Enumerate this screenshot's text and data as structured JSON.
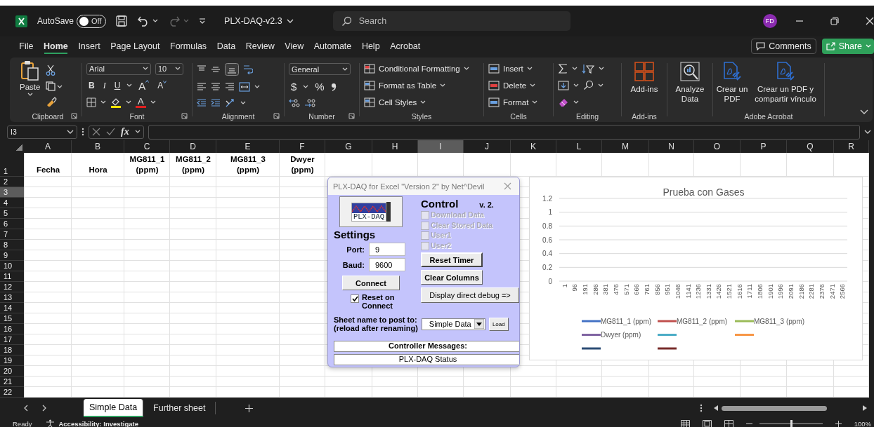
{
  "title_bar": {
    "autosave_label": "AutoSave",
    "autosave": {
      "on": false,
      "label": "Off"
    },
    "file_name": "PLX-DAQ-v2.3",
    "search_placeholder": "Search",
    "avatar": "FD"
  },
  "menu_tabs": [
    {
      "label": "File",
      "selected": false
    },
    {
      "label": "Home",
      "selected": true
    },
    {
      "label": "Insert",
      "selected": false
    },
    {
      "label": "Page Layout",
      "selected": false
    },
    {
      "label": "Formulas",
      "selected": false
    },
    {
      "label": "Data",
      "selected": false
    },
    {
      "label": "Review",
      "selected": false
    },
    {
      "label": "View",
      "selected": false
    },
    {
      "label": "Automate",
      "selected": false
    },
    {
      "label": "Help",
      "selected": false
    },
    {
      "label": "Acrobat",
      "selected": false
    }
  ],
  "header_buttons": {
    "comments": "Comments",
    "share": "Share"
  },
  "ribbon": {
    "clipboard": {
      "paste": "Paste",
      "label": "Clipboard"
    },
    "font": {
      "name": "Arial",
      "size": "10",
      "format_buttons": [
        "B",
        "I",
        "U"
      ],
      "grow": "A",
      "shrink": "A",
      "font_color": "A",
      "label": "Font"
    },
    "alignment": {
      "label": "Alignment"
    },
    "number": {
      "format": "General",
      "currency": "$",
      "percent": "%",
      "label": "Number"
    },
    "styles": {
      "items": [
        "Conditional Formatting",
        "Format as Table",
        "Cell Styles"
      ],
      "label": "Styles"
    },
    "cells": {
      "items": [
        "Insert",
        "Delete",
        "Format"
      ],
      "label": "Cells"
    },
    "editing": {
      "label": "Editing"
    },
    "addins": {
      "button": "Add-ins",
      "label": "Add-ins"
    },
    "analyze": {
      "button": "Analyze Data"
    },
    "acrobat": {
      "buttons": [
        "Crear un PDF",
        "Crear un PDF y compartir vínculo"
      ],
      "label": "Adobe Acrobat"
    }
  },
  "formula_bar": {
    "name_box": "I3",
    "function_label": "fx"
  },
  "sheet": {
    "columns": [
      {
        "label": "A",
        "selected": false
      },
      {
        "label": "B",
        "selected": false
      },
      {
        "label": "C",
        "selected": false
      },
      {
        "label": "D",
        "selected": false
      },
      {
        "label": "E",
        "selected": false
      },
      {
        "label": "F",
        "selected": false
      },
      {
        "label": "G",
        "selected": false
      },
      {
        "label": "H",
        "selected": false
      },
      {
        "label": "I",
        "selected": true
      },
      {
        "label": "J",
        "selected": false
      },
      {
        "label": "K",
        "selected": false
      },
      {
        "label": "L",
        "selected": false
      },
      {
        "label": "M",
        "selected": false
      },
      {
        "label": "N",
        "selected": false
      },
      {
        "label": "O",
        "selected": false
      },
      {
        "label": "P",
        "selected": false
      },
      {
        "label": "Q",
        "selected": false
      },
      {
        "label": "R",
        "selected": false
      }
    ],
    "rows": [
      {
        "label": "1",
        "selected": false
      },
      {
        "label": "2",
        "selected": false
      },
      {
        "label": "3",
        "selected": true
      },
      {
        "label": "4",
        "selected": false
      },
      {
        "label": "5",
        "selected": false
      },
      {
        "label": "6",
        "selected": false
      },
      {
        "label": "7",
        "selected": false
      },
      {
        "label": "8",
        "selected": false
      },
      {
        "label": "9",
        "selected": false
      },
      {
        "label": "10",
        "selected": false
      },
      {
        "label": "11",
        "selected": false
      },
      {
        "label": "12",
        "selected": false
      },
      {
        "label": "13",
        "selected": false
      },
      {
        "label": "14",
        "selected": false
      },
      {
        "label": "15",
        "selected": false
      },
      {
        "label": "16",
        "selected": false
      },
      {
        "label": "17",
        "selected": false
      },
      {
        "label": "18",
        "selected": false
      },
      {
        "label": "19",
        "selected": false
      },
      {
        "label": "20",
        "selected": false
      },
      {
        "label": "21",
        "selected": false
      },
      {
        "label": "22",
        "selected": false
      }
    ],
    "header_cells": [
      "Fecha",
      "Hora",
      "MG811_1 (ppm)",
      "MG811_2 (ppm)",
      "MG811_3 (ppm)",
      "Dwyer (ppm)"
    ]
  },
  "dialog": {
    "title": "PLX-DAQ for Excel \"Version 2\" by Net^Devil",
    "logo_text": "PLX-DAQ",
    "settings_heading": "Settings",
    "port_label": "Port:",
    "port_value": "9",
    "baud_label": "Baud:",
    "baud_value": "9600",
    "connect": "Connect",
    "reset_on_connect": {
      "label": "Reset on Connect",
      "checked": true
    },
    "control_heading": "Control",
    "version": "v. 2.",
    "control_options": [
      {
        "label": "Download Data",
        "checked": false,
        "disabled": true
      },
      {
        "label": "Clear Stored Data",
        "checked": false,
        "disabled": true
      },
      {
        "label": "User1",
        "checked": false,
        "disabled": true
      },
      {
        "label": "User2",
        "checked": false,
        "disabled": true
      }
    ],
    "control_buttons": [
      "Reset Timer",
      "Clear Columns",
      "Display direct debug =>"
    ],
    "sheet_label": "Sheet name to post to:",
    "sheet_hint": "(reload after renaming)",
    "sheet_value": "Simple Data",
    "load": "Load",
    "messages_label": "Controller Messages:",
    "status": "PLX-DAQ Status"
  },
  "chart": {
    "chart_data": {
      "type": "line",
      "title": "Prueba con Gases",
      "categories": [
        "1",
        "96",
        "191",
        "286",
        "381",
        "476",
        "571",
        "666",
        "761",
        "856",
        "951",
        "1046",
        "1141",
        "1236",
        "1331",
        "1426",
        "1521",
        "1616",
        "1711",
        "1806",
        "1901",
        "1996",
        "2091",
        "2186",
        "2281",
        "2376",
        "2471",
        "2566"
      ],
      "ylim": [
        0,
        1.2
      ],
      "grid": true,
      "yticks": [
        0,
        0.2,
        0.4,
        0.6,
        0.8,
        1,
        1.2
      ],
      "series": [
        {
          "name": "MG811_1 (ppm)",
          "color": "#4472c4",
          "values": [
            null,
            null,
            null,
            null,
            null,
            null,
            null,
            null,
            null,
            null,
            null,
            null,
            null,
            null,
            null,
            null,
            null,
            null,
            null,
            null,
            null,
            null,
            null,
            null,
            null,
            null,
            null,
            null
          ]
        },
        {
          "name": "MG811_2 (ppm)",
          "color": "#c0504d",
          "values": [
            null,
            null,
            null,
            null,
            null,
            null,
            null,
            null,
            null,
            null,
            null,
            null,
            null,
            null,
            null,
            null,
            null,
            null,
            null,
            null,
            null,
            null,
            null,
            null,
            null,
            null,
            null,
            null
          ]
        },
        {
          "name": "MG811_3 (ppm)",
          "color": "#9bbb59",
          "values": [
            null,
            null,
            null,
            null,
            null,
            null,
            null,
            null,
            null,
            null,
            null,
            null,
            null,
            null,
            null,
            null,
            null,
            null,
            null,
            null,
            null,
            null,
            null,
            null,
            null,
            null,
            null,
            null
          ]
        },
        {
          "name": "Dwyer (ppm)",
          "color": "#8064a2",
          "values": [
            null,
            null,
            null,
            null,
            null,
            null,
            null,
            null,
            null,
            null,
            null,
            null,
            null,
            null,
            null,
            null,
            null,
            null,
            null,
            null,
            null,
            null,
            null,
            null,
            null,
            null,
            null,
            null
          ]
        },
        {
          "color": "#4bacc6",
          "values": [
            null,
            null,
            null,
            null,
            null,
            null,
            null,
            null,
            null,
            null,
            null,
            null,
            null,
            null,
            null,
            null,
            null,
            null,
            null,
            null,
            null,
            null,
            null,
            null,
            null,
            null,
            null,
            null
          ]
        },
        {
          "color": "#f79646",
          "values": [
            null,
            null,
            null,
            null,
            null,
            null,
            null,
            null,
            null,
            null,
            null,
            null,
            null,
            null,
            null,
            null,
            null,
            null,
            null,
            null,
            null,
            null,
            null,
            null,
            null,
            null,
            null,
            null
          ]
        },
        {
          "color": "#2c4d75",
          "values": [
            null,
            null,
            null,
            null,
            null,
            null,
            null,
            null,
            null,
            null,
            null,
            null,
            null,
            null,
            null,
            null,
            null,
            null,
            null,
            null,
            null,
            null,
            null,
            null,
            null,
            null,
            null,
            null
          ]
        },
        {
          "color": "#772c2a",
          "values": [
            null,
            null,
            null,
            null,
            null,
            null,
            null,
            null,
            null,
            null,
            null,
            null,
            null,
            null,
            null,
            null,
            null,
            null,
            null,
            null,
            null,
            null,
            null,
            null,
            null,
            null,
            null,
            null
          ]
        }
      ]
    }
  },
  "sheet_tabs": [
    {
      "label": "Simple Data",
      "selected": true
    },
    {
      "label": "Further sheet",
      "selected": false
    }
  ],
  "status_bar": {
    "ready": "Ready",
    "accessibility": "Accessibility: Investigate",
    "zoom_level": {
      "level": 0.5
    },
    "zoom": "100%"
  }
}
